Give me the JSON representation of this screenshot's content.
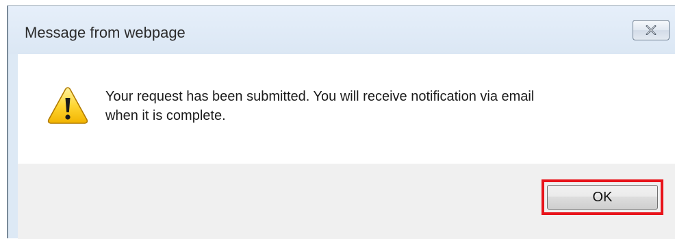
{
  "dialog": {
    "title": "Message from webpage",
    "message_line1": "Your request has been submitted. You will receive notification via email",
    "message_line2": "when it is complete.",
    "icon": "warning-icon",
    "ok_label": "OK",
    "close_icon": "close-icon",
    "highlight_color": "#e8141b"
  }
}
